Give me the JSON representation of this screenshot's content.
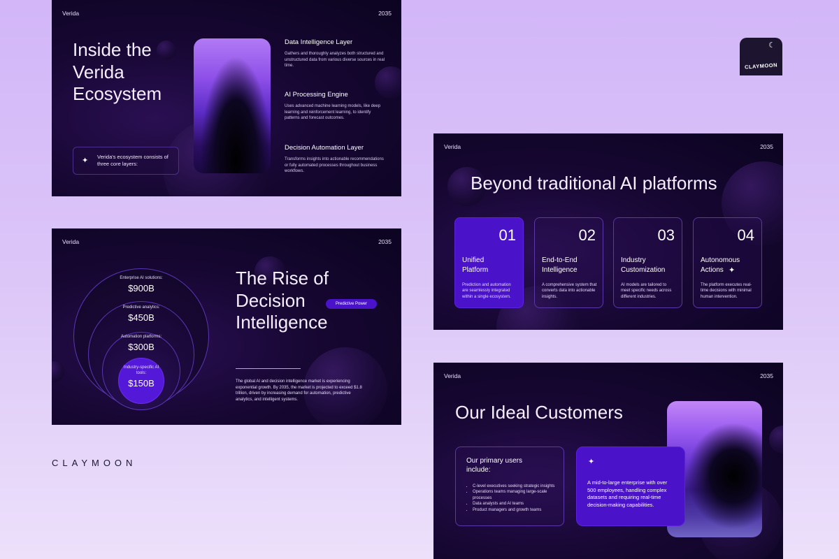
{
  "brand": {
    "wordmark": "CLAYMOON",
    "badge_text": "CLAYMOON",
    "badge_icon": "moon-star-icon"
  },
  "colors": {
    "background": "#d8bff8",
    "slide_dark": "#170733",
    "accent_purple": "#4a12c9",
    "glow_violet": "#b17af5"
  },
  "slide1": {
    "header_left": "Verida",
    "header_right": "2035",
    "title_lines": [
      "Inside the",
      "Verida",
      "Ecosystem"
    ],
    "callout": "Verida's ecosystem consists of three core layers:",
    "layers": [
      {
        "title": "Data Intelligence Layer",
        "text": "Gathers and thoroughly analyzes both structured and unstructured data from various diverse sources in real time."
      },
      {
        "title": "AI Processing Engine",
        "text": "Uses advanced machine learning models, like deep learning and reinforcement learning, to identify patterns and forecast outcomes."
      },
      {
        "title": "Decision Automation Layer",
        "text": "Transforms insights into actionable recommendations or fully automated processes throughout business workflows."
      }
    ]
  },
  "slide2": {
    "header_left": "Verida",
    "header_right": "2035",
    "title_lines": [
      "The Rise of",
      "Decision",
      "Intelligence"
    ],
    "pill": "Predictive Power",
    "rings": [
      {
        "label": "Enterprise AI solutions:",
        "value": "$900B"
      },
      {
        "label": "Predictive analytics:",
        "value": "$450B"
      },
      {
        "label": "Automation platforms:",
        "value": "$300B"
      },
      {
        "label": "Industry-specific AI tools:",
        "value": "$150B"
      }
    ],
    "body": "The global AI and decision intelligence market is experiencing exponential growth. By 2035, the market is projected to exceed $1.8 trillion, driven by increasing demand for automation, predictive analytics, and intelligent systems."
  },
  "slide3": {
    "header_left": "Verida",
    "header_right": "2035",
    "title": "Beyond traditional AI platforms",
    "cards": [
      {
        "num": "01",
        "label_lines": [
          "Unified",
          "Platform"
        ],
        "text": "Prediction and automation are seamlessly integrated within a single ecosystem."
      },
      {
        "num": "02",
        "label_lines": [
          "End-to-End",
          "Intelligence"
        ],
        "text": "A comprehensive system that converts data into actionable insights."
      },
      {
        "num": "03",
        "label_lines": [
          "Industry",
          "Customization"
        ],
        "text": "AI models are tailored to meet specific needs across different industries."
      },
      {
        "num": "04",
        "label_lines": [
          "Autonomous",
          "Actions"
        ],
        "text": "The platform executes real-time decisions with minimal human intervention."
      }
    ]
  },
  "slide4": {
    "header_left": "Verida",
    "header_right": "2035",
    "title": "Our Ideal Customers",
    "users_title": "Our primary users include:",
    "users": [
      "C-level executives seeking strategic insights",
      "Operations teams managing large-scale processes",
      "Data analysts and AI teams",
      "Product managers and growth teams"
    ],
    "highlight": "A mid-to-large enterprise with over 500 employees, handling complex datasets and requiring real-time decision-making capabilities."
  }
}
